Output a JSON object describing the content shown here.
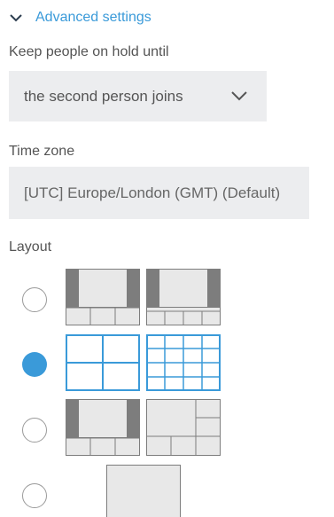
{
  "advanced_settings": {
    "label": "Advanced settings",
    "icon": "chevron-down-icon"
  },
  "hold": {
    "label": "Keep people on hold until",
    "selected": "the second person joins",
    "icon": "chevron-down-icon"
  },
  "timezone": {
    "label": "Time zone",
    "value": "[UTC] Europe/London (GMT) (Default)"
  },
  "layout": {
    "label": "Layout",
    "selected_index": 1,
    "options": [
      {
        "thumbnails": [
          "layout-sidebars-bottom-strip",
          "layout-sidebars-bottom-strip-4"
        ]
      },
      {
        "thumbnails": [
          "layout-grid-2x2",
          "layout-grid-4x4"
        ]
      },
      {
        "thumbnails": [
          "layout-sidebars-bottom-strip",
          "layout-right-column-bottom-strip"
        ]
      },
      {
        "thumbnails": [
          "layout-single"
        ]
      }
    ]
  },
  "colors": {
    "accent": "#3a9ad9",
    "text": "#555555",
    "field_bg": "#ecedef",
    "thumb_dark": "#7d7d7d",
    "thumb_light": "#e8e8e8"
  }
}
